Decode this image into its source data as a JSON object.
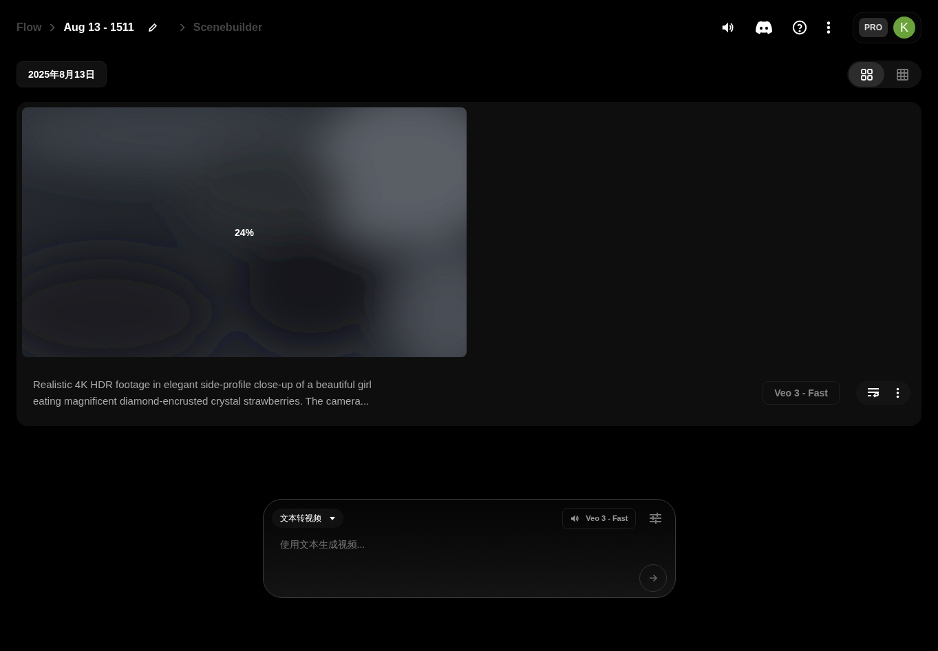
{
  "breadcrumbs": [
    {
      "label": "Flow",
      "current": false
    },
    {
      "label": "Aug 13 - 1511",
      "current": true
    },
    {
      "label": "Scenebuilder",
      "current": false
    }
  ],
  "header": {
    "plan_badge": "PRO",
    "avatar_initial": "K"
  },
  "date_chip": "2025年8月13日",
  "view_toggle": [
    {
      "kind": "grid",
      "selected": true
    },
    {
      "kind": "table",
      "selected": false
    }
  ],
  "generation": {
    "progress": "24%",
    "prompt": "Realistic 4K HDR footage in elegant side-profile close-up of a beautiful girl\neating magnificent diamond-encrusted crystal strawberries. The camera...",
    "model": "Veo 3 - Fast"
  },
  "composer": {
    "mode": "文本转视频",
    "model": "Veo 3 - Fast",
    "placeholder": "使用文本生成视频..."
  }
}
